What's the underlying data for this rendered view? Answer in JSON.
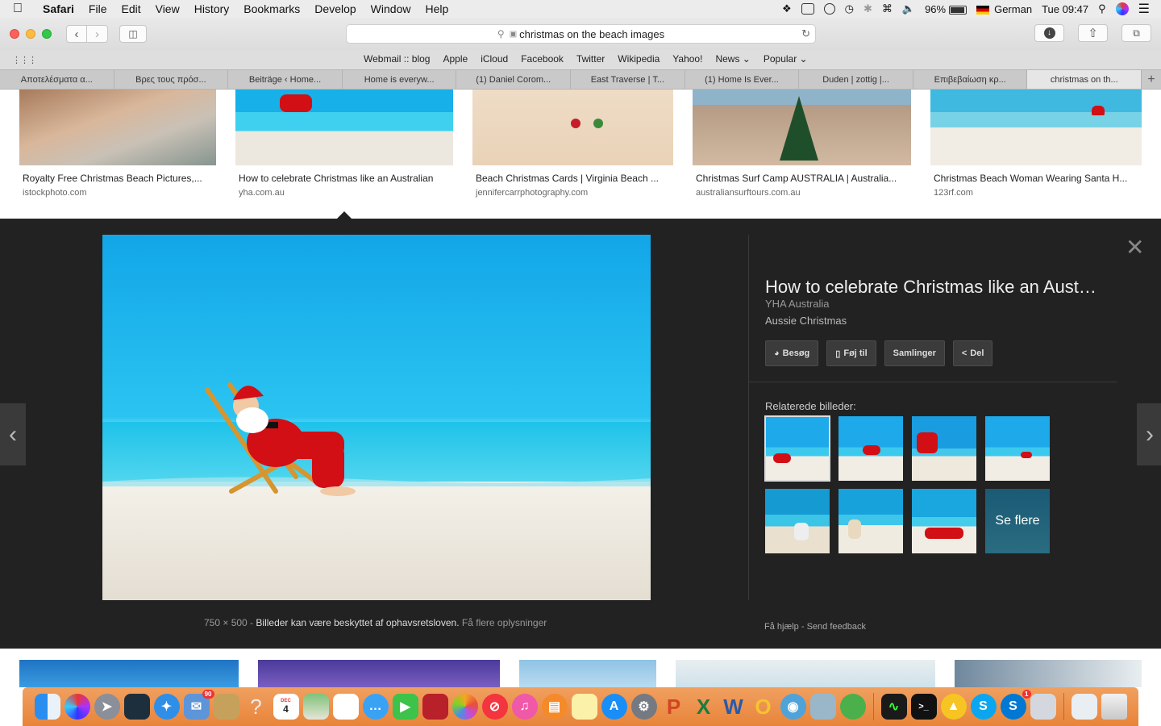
{
  "menubar": {
    "app": "Safari",
    "menus": [
      "File",
      "Edit",
      "View",
      "History",
      "Bookmarks",
      "Develop",
      "Window",
      "Help"
    ],
    "battery": "96%",
    "input_source": "German",
    "clock": "Tue 09:47"
  },
  "toolbar": {
    "url_text": "christmas on the beach images"
  },
  "favorites": [
    "Webmail :: blog",
    "Apple",
    "iCloud",
    "Facebook",
    "Twitter",
    "Wikipedia",
    "Yahoo!",
    "News ⌄",
    "Popular ⌄"
  ],
  "tabs": [
    {
      "label": "Αποτελέσματα α..."
    },
    {
      "label": "Βρες τους πρόσ..."
    },
    {
      "label": "Beiträge ‹ Home..."
    },
    {
      "label": "Home is everyw..."
    },
    {
      "label": "(1) Daniel Corom..."
    },
    {
      "label": "East Traverse | T..."
    },
    {
      "label": "(1) Home Is Ever..."
    },
    {
      "label": "Duden | zottig |..."
    },
    {
      "label": "Επιβεβαίωση κρ..."
    },
    {
      "label": "christmas on th..."
    }
  ],
  "results": [
    {
      "title": "Royalty Free Christmas Beach Pictures,...",
      "site": "istockphoto.com"
    },
    {
      "title": "How to celebrate Christmas like an Australian",
      "site": "yha.com.au"
    },
    {
      "title": "Beach Christmas Cards | Virginia Beach ...",
      "site": "jennifercarrphotography.com"
    },
    {
      "title": "Christmas Surf Camp AUSTRALIA | Australia...",
      "site": "australiansurftours.com.au"
    },
    {
      "title": "Christmas Beach Woman Wearing Santa H...",
      "site": "123rf.com"
    }
  ],
  "panel": {
    "title": "How to celebrate Christmas like an Aust…",
    "site": "YHA Australia",
    "description": "Aussie Christmas",
    "actions": [
      "Besøg",
      "Føj til",
      "Samlinger",
      "Del"
    ],
    "related_label": "Relaterede billeder:",
    "see_more": "Se flere",
    "dimensions": "750 × 500",
    "sep": "-",
    "copyright": "Billeder kan være beskyttet af ophavsretsloven.",
    "more_info": "Få flere oplysninger",
    "help": "Få hjælp",
    "feedback": "Send feedback"
  },
  "dock": {
    "mail_badge": "90",
    "skype_badge": "1",
    "calendar_day": "4",
    "calendar_month": "DEC"
  },
  "colors": {
    "panel_bg": "#222222",
    "dock": "#e8843a",
    "santa_red": "#d10f14",
    "sky": "#12a6e8"
  }
}
